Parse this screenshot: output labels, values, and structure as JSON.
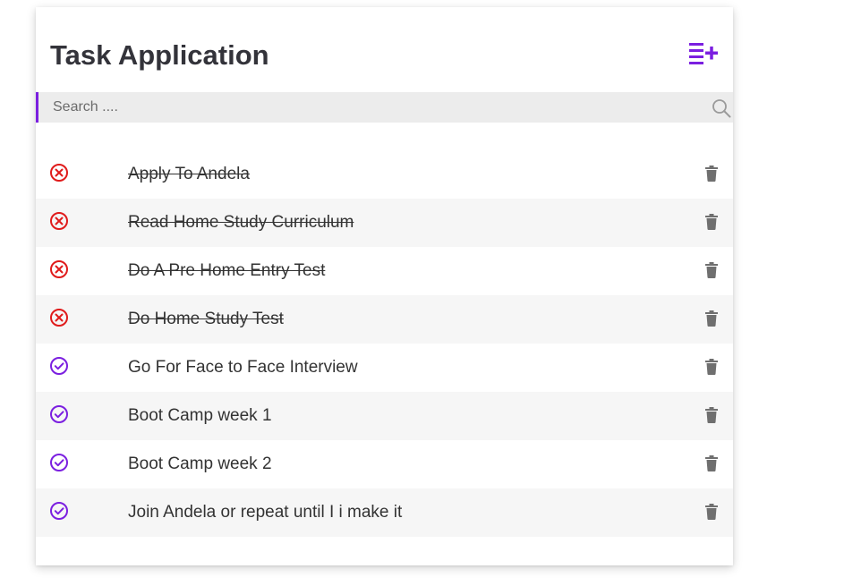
{
  "app": {
    "title": "Task Application",
    "accent_color": "#7b1fe0",
    "add_icon": "playlist-add-icon"
  },
  "search": {
    "placeholder": "Search ....",
    "value": "",
    "icon": "search-icon"
  },
  "status_colors": {
    "done": "#e01b1b",
    "pending": "#7b1fe0"
  },
  "tasks": [
    {
      "label": "Apply To Andela",
      "completed": true,
      "status_icon": "close-circle-icon"
    },
    {
      "label": "Read Home Study Curriculum",
      "completed": true,
      "status_icon": "close-circle-icon"
    },
    {
      "label": "Do A Pre Home Entry Test",
      "completed": true,
      "status_icon": "close-circle-icon"
    },
    {
      "label": "Do Home Study Test",
      "completed": true,
      "status_icon": "close-circle-icon"
    },
    {
      "label": "Go For Face to Face Interview",
      "completed": false,
      "status_icon": "check-circle-icon"
    },
    {
      "label": "Boot Camp week 1",
      "completed": false,
      "status_icon": "check-circle-icon"
    },
    {
      "label": "Boot Camp week 2",
      "completed": false,
      "status_icon": "check-circle-icon"
    },
    {
      "label": "Join Andela or repeat until I i make it",
      "completed": false,
      "status_icon": "check-circle-icon"
    }
  ]
}
